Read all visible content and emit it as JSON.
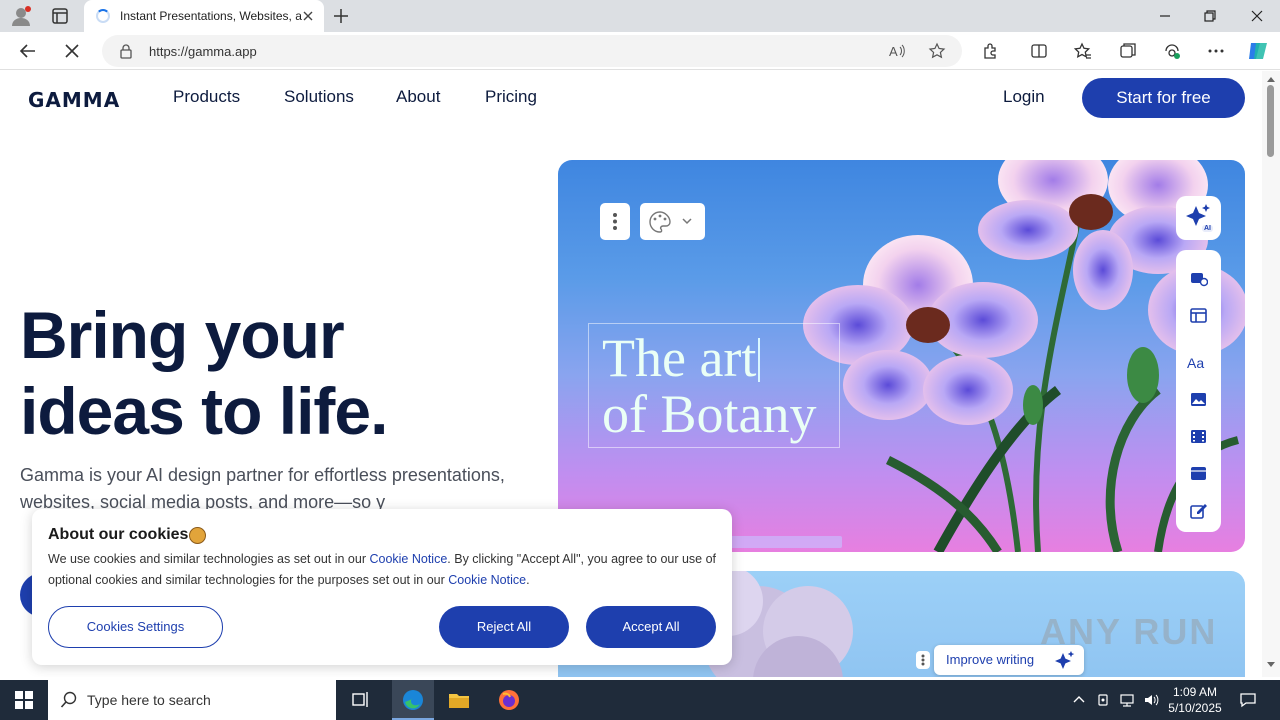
{
  "browser": {
    "tab_title": "Instant Presentations, Websites, a",
    "url": "https://gamma.app"
  },
  "site": {
    "logo": "GAMMA",
    "nav": [
      "Products",
      "Solutions",
      "About",
      "Pricing"
    ],
    "login": "Login",
    "start": "Start for free"
  },
  "hero": {
    "line1": "Bring your",
    "line2": "ideas to life.",
    "subtitle": "Gamma is your AI design partner for effortless presentations, websites, social media posts, and more—so y"
  },
  "card": {
    "title_line1": "The art",
    "title_line2": "of Botany",
    "ai_badge": "AI",
    "improve_writing": "Improve writing"
  },
  "cookie": {
    "title": "About our cookies",
    "text_before_link1": "We use cookies and similar technologies as set out in our ",
    "link1": "Cookie Notice",
    "text_middle": ". By clicking \"Accept All\", you agree to our use of optional cookies and similar technologies for the purposes set out in our ",
    "link2": "Cookie Notice",
    "text_end": ".",
    "settings_label": "Cookies Settings",
    "reject_label": "Reject All",
    "accept_label": "Accept All"
  },
  "watermark": "ANY RUN",
  "taskbar": {
    "search_placeholder": "Type here to search",
    "time": "1:09 AM",
    "date": "5/10/2025"
  },
  "colors": {
    "brand": "#1e3fae",
    "navy": "#0d1b3e",
    "taskbar": "#1f2b3a"
  }
}
